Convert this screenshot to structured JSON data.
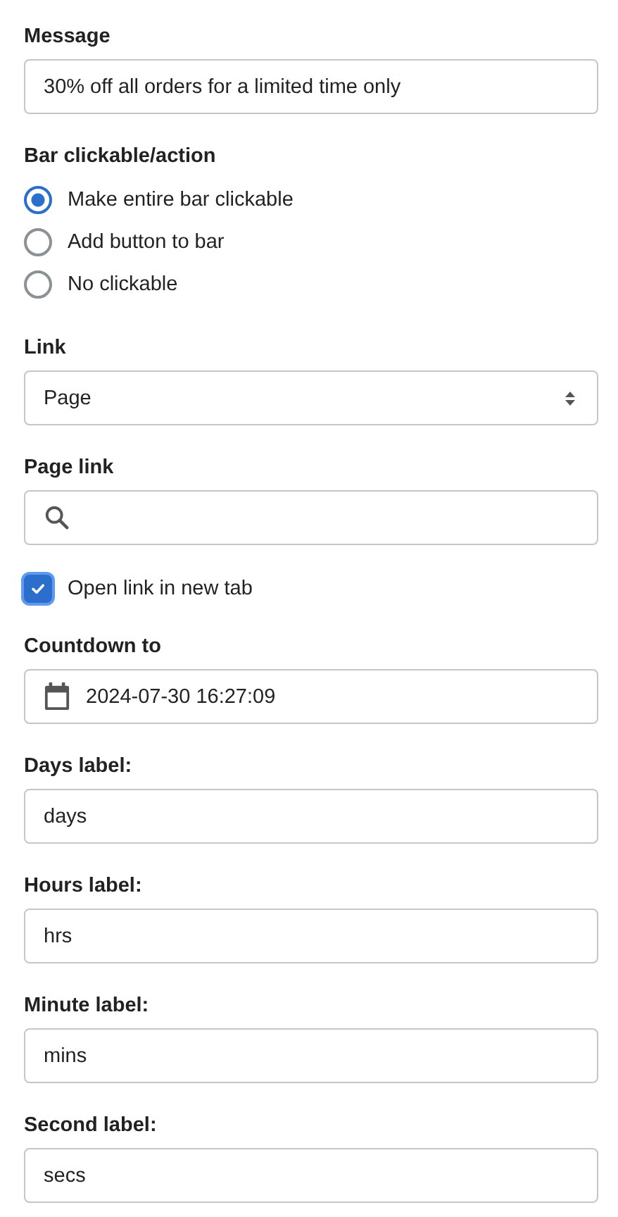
{
  "fields": [
    {
      "kind": "text",
      "label": "Message",
      "value": "30% off all orders for a limited time only"
    },
    {
      "kind": "radio",
      "label": "Bar clickable/action",
      "options": [
        {
          "label": "Make entire bar clickable",
          "selected": true
        },
        {
          "label": "Add button to bar",
          "selected": false
        },
        {
          "label": "No clickable",
          "selected": false
        }
      ]
    },
    {
      "kind": "select",
      "label": "Link",
      "value": "Page"
    },
    {
      "kind": "search",
      "label": "Page link"
    },
    {
      "kind": "checkbox",
      "label": "Open link in new tab",
      "checked": true
    },
    {
      "kind": "datetime",
      "label": "Countdown to",
      "value": "2024-07-30 16:27:09"
    },
    {
      "kind": "text",
      "label": "Days label:",
      "value": "days"
    },
    {
      "kind": "text",
      "label": "Hours label:",
      "value": "hrs"
    },
    {
      "kind": "text",
      "label": "Minute label:",
      "value": "mins"
    },
    {
      "kind": "text",
      "label": "Second label:",
      "value": "secs"
    }
  ]
}
